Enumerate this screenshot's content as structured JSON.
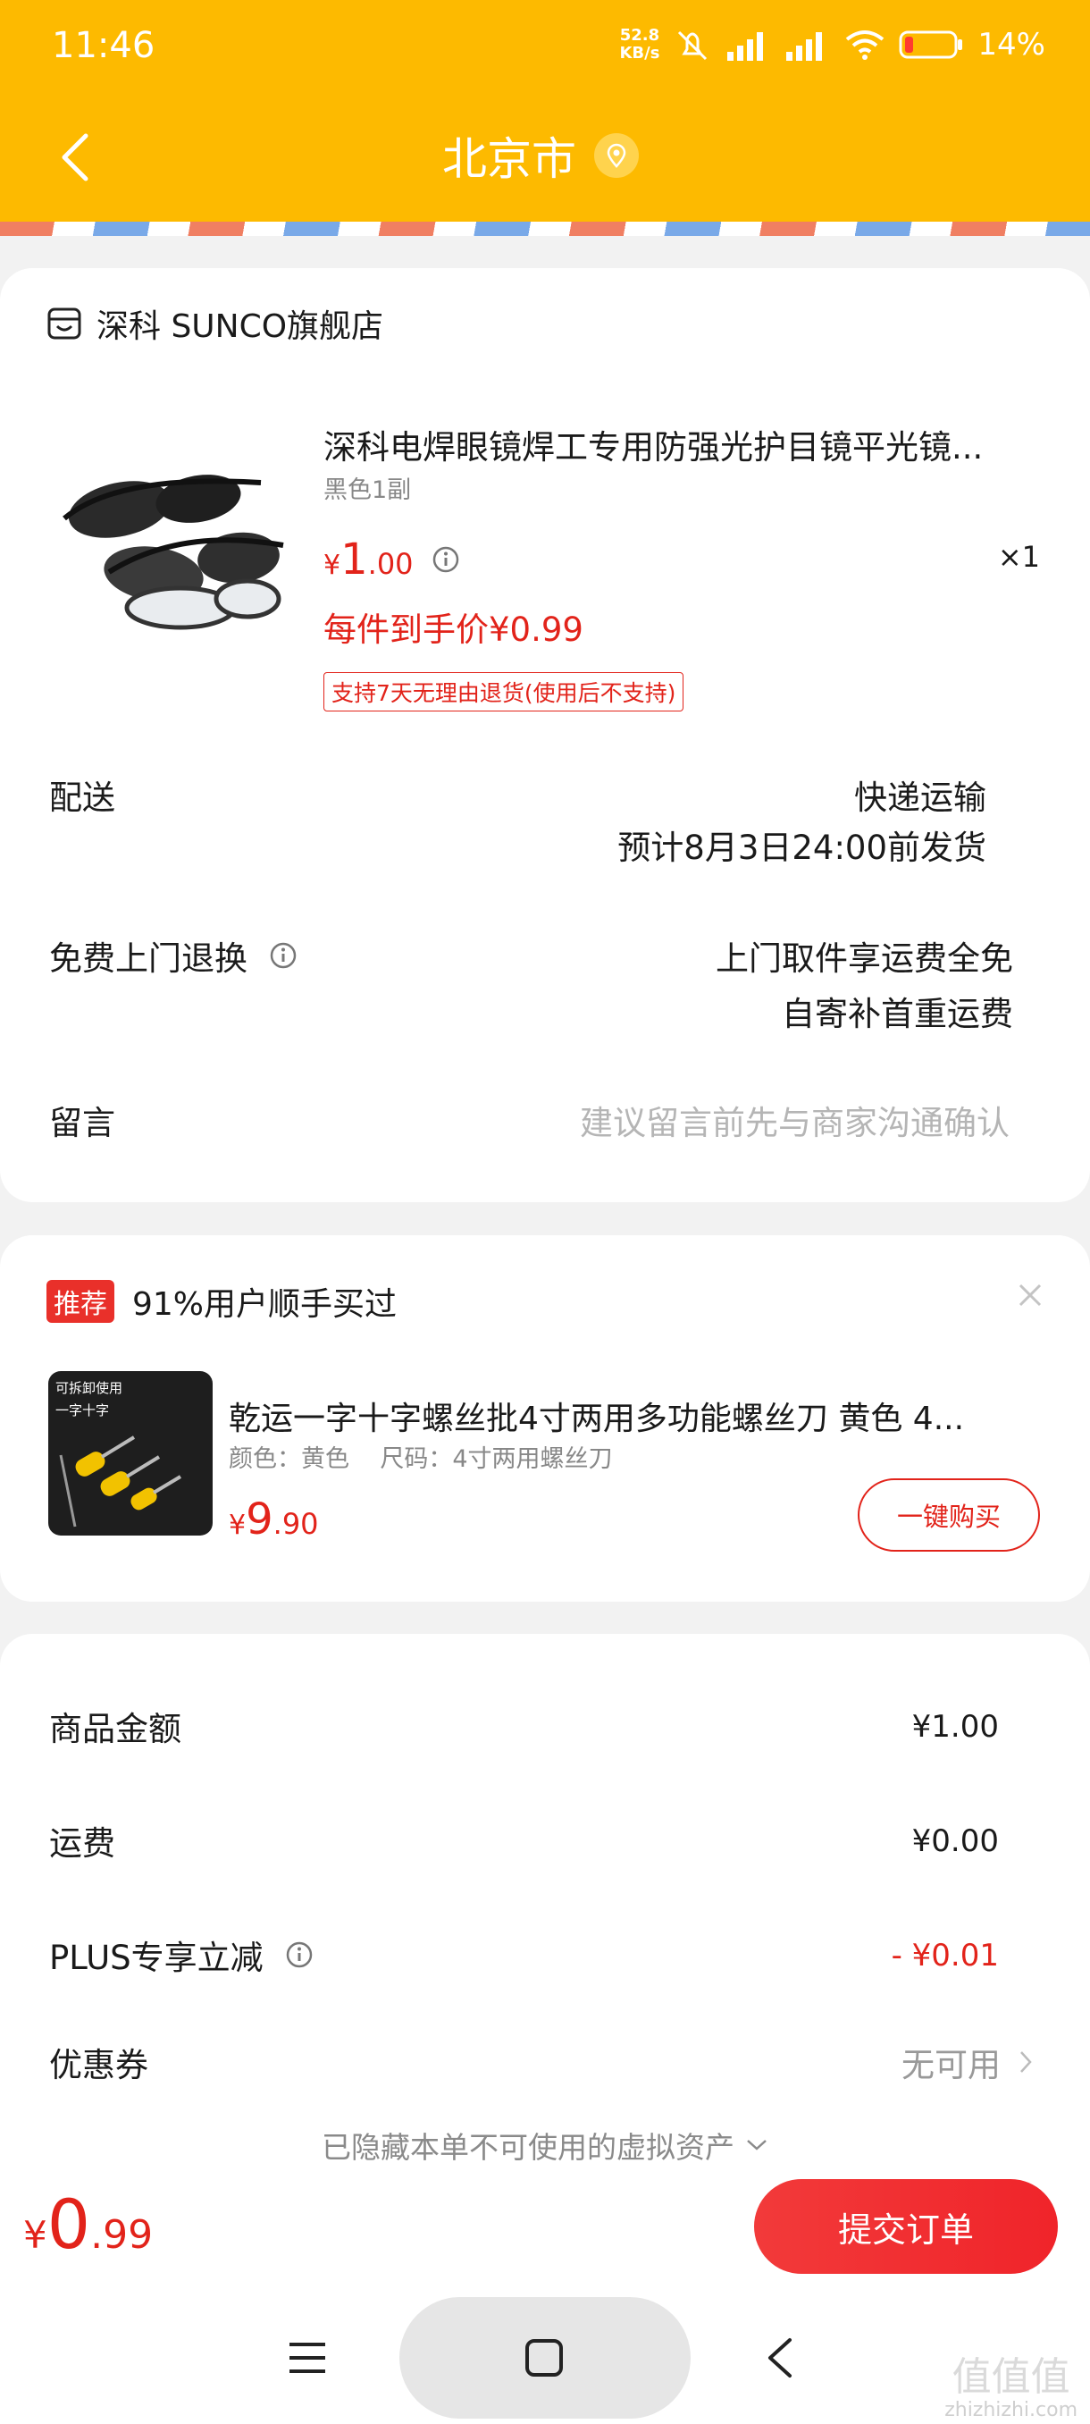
{
  "status_bar": {
    "time": "11:46",
    "speed_value": "52.8",
    "speed_unit": "KB/s",
    "battery_percent": "14%"
  },
  "nav": {
    "title": "北京市"
  },
  "order": {
    "store_name": "深科 SUNCO旗舰店",
    "product_title": "深科电焊眼镜焊工专用防强光护目镜平光镜...",
    "product_spec": "黑色1副",
    "price_symbol": "¥",
    "price_int": "1",
    "price_dec": ".00",
    "quantity": "×1",
    "per_price": "每件到手价¥0.99",
    "return_tag": "支持7天无理由退货(使用后不支持)",
    "delivery_label": "配送",
    "delivery_method": "快递运输",
    "delivery_eta": "预计8月3日24:00前发货",
    "free_return_label": "免费上门退换",
    "free_return_line1": "上门取件享运费全免",
    "free_return_line2": "自寄补首重运费",
    "message_label": "留言",
    "message_placeholder": "建议留言前先与商家沟通确认"
  },
  "recommend": {
    "badge": "推荐",
    "headline": "91%用户顺手买过",
    "img_text1": "可拆卸使用",
    "img_text2": "一字十字",
    "product_title": "乾运一字十字螺丝批4寸两用多功能螺丝刀 黄色 4...",
    "product_spec": "颜色：黄色    尺码：4寸两用螺丝刀",
    "price_symbol": "¥",
    "price_int": "9",
    "price_dec": ".90",
    "buy_label": "一键购买"
  },
  "summary": {
    "goods_label": "商品金额",
    "goods_value": "¥1.00",
    "shipping_label": "运费",
    "shipping_value": "¥0.00",
    "plus_label": "PLUS专享立减",
    "plus_value": "- ¥0.01",
    "coupon_label": "优惠券",
    "coupon_value": "无可用",
    "hidden_assets": "已隐藏本单不可使用的虚拟资产"
  },
  "bottom": {
    "total_symbol": "¥",
    "total_int": "0",
    "total_dec": ".99",
    "submit_label": "提交订单"
  },
  "watermark": {
    "line1": "值值值",
    "line2": "zhizhizhi.com"
  },
  "colors": {
    "brand_yellow": "#fdba00",
    "accent_red": "#e2231a"
  }
}
